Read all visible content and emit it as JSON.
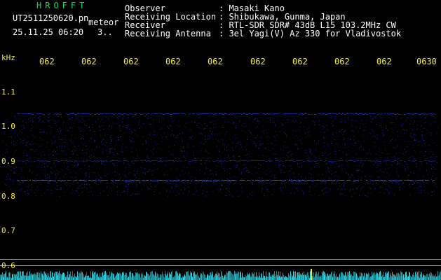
{
  "header": {
    "logo": "HROFFT",
    "filename": "UT2511250620.pn",
    "filename_suffix": "meteor",
    "datetime": "25.11.25 06:20",
    "mode": "3..",
    "fields": [
      {
        "label": "Observer",
        "value": ": Masaki Kano"
      },
      {
        "label": "Receiving Location",
        "value": ": Shibukawa, Gunma, Japan"
      },
      {
        "label": "Receiver",
        "value": ": RTL-SDR SDR# 43dB L15 103.2MHz CW"
      },
      {
        "label": "Receiving Antenna",
        "value": ": 3el Yagi(V) Az 330 for Vladivostok"
      }
    ]
  },
  "axis": {
    "unit": "kHz",
    "y_ticks": [
      "1.1",
      "1.0",
      "0.9",
      "0.8",
      "0.7",
      "0.6"
    ],
    "x_ticks": [
      "062",
      "062",
      "062",
      "062",
      "062",
      "062",
      "062",
      "062",
      "062",
      "0630"
    ]
  },
  "colors": {
    "background": "#000000",
    "header_green": "#00e05a",
    "label_yellow": "#f4ee3a",
    "signal_blue": "#2a3cff",
    "noise_cyan": "#2fd8e8"
  }
}
